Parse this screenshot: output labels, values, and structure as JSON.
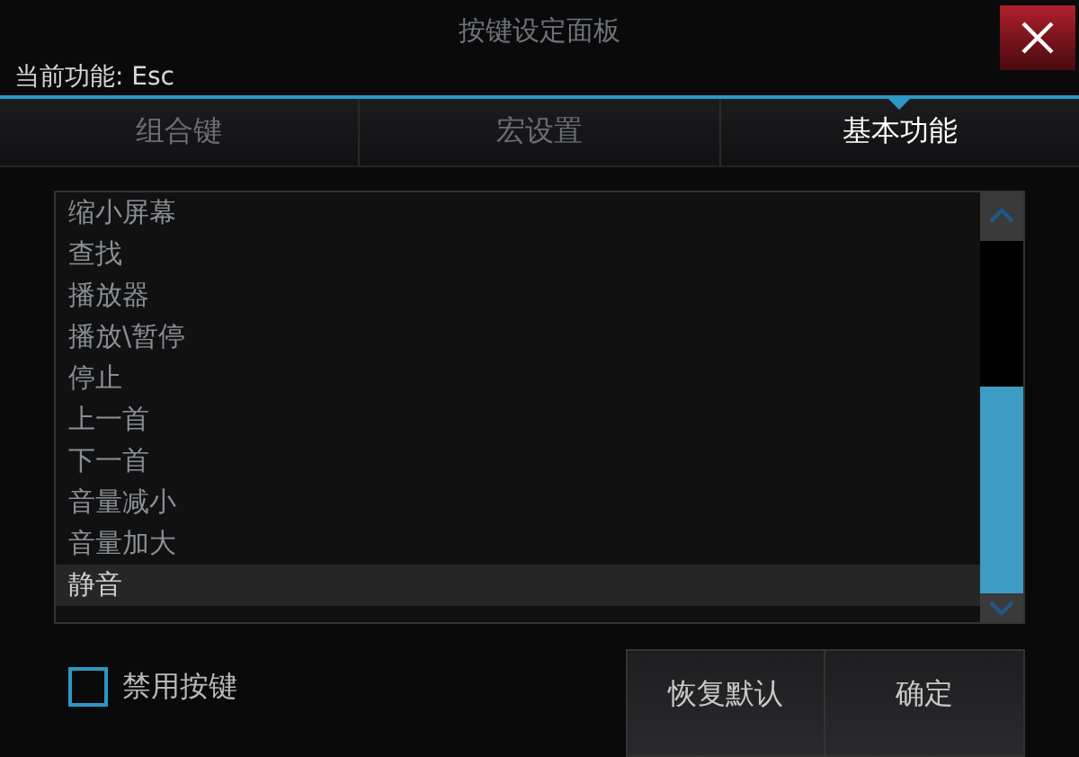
{
  "window": {
    "title": "按键设定面板",
    "current_function": "当前功能: Esc"
  },
  "tabs": [
    {
      "label": "组合键",
      "selected": false
    },
    {
      "label": "宏设置",
      "selected": false
    },
    {
      "label": "基本功能",
      "selected": true
    }
  ],
  "list": [
    {
      "label": "缩小屏幕",
      "selected": false
    },
    {
      "label": "查找",
      "selected": false
    },
    {
      "label": "播放器",
      "selected": false
    },
    {
      "label": "播放\\暂停",
      "selected": false
    },
    {
      "label": "停止",
      "selected": false
    },
    {
      "label": "上一首",
      "selected": false
    },
    {
      "label": "下一首",
      "selected": false
    },
    {
      "label": "音量减小",
      "selected": false
    },
    {
      "label": "音量加大",
      "selected": false
    },
    {
      "label": "静音",
      "selected": true
    }
  ],
  "disable_key": {
    "label": "禁用按键",
    "checked": false
  },
  "buttons": [
    "恢复默认",
    "确定"
  ]
}
